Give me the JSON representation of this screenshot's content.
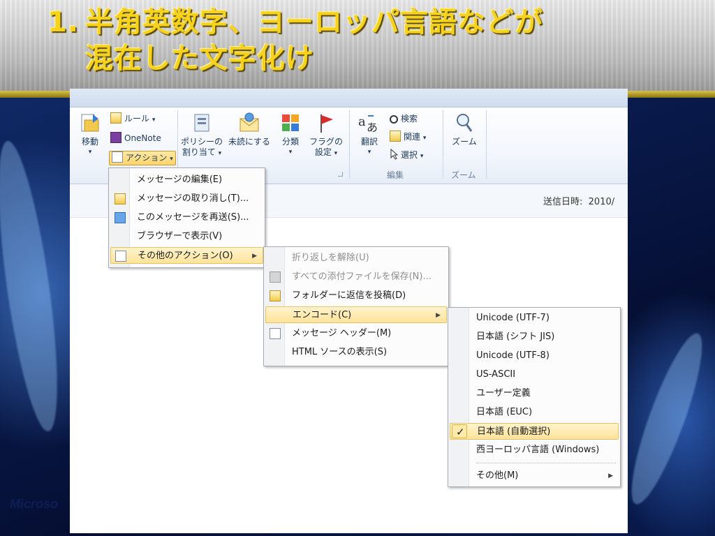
{
  "slide": {
    "title_number": "1.",
    "title_line1": "半角英数字、ヨーロッパ言語などが",
    "title_line2": "混在した文字化け",
    "footer": "Microso"
  },
  "ribbon": {
    "move_label": "移動",
    "rules_label": "ルール",
    "onenote_label": "OneNote",
    "actions_label": "アクション",
    "policy_label_1": "ポリシーの",
    "policy_label_2": "割り当て",
    "unread_label": "未読にする",
    "categorize_label": "分類",
    "flag_label_1": "フラグの",
    "flag_label_2": "設定",
    "translate_label": "翻訳",
    "find_label": "検索",
    "related_label": "関連",
    "select_label": "選択",
    "edit_group": "編集",
    "zoom_label": "ズーム",
    "zoom_group": "ズーム"
  },
  "info": {
    "sent_label": "送信日時:",
    "sent_value": "2010/"
  },
  "menu_actions": [
    {
      "label": "メッセージの編集(E)"
    },
    {
      "label": "メッセージの取り消し(T)..."
    },
    {
      "label": "このメッセージを再送(S)..."
    },
    {
      "label": "ブラウザーで表示(V)"
    },
    {
      "label": "その他のアクション(O)"
    }
  ],
  "menu_other": [
    {
      "label": "折り返しを解除(U)"
    },
    {
      "label": "すべての添付ファイルを保存(N)..."
    },
    {
      "label": "フォルダーに返信を投稿(D)"
    },
    {
      "label": "エンコード(C)"
    },
    {
      "label": "メッセージ ヘッダー(M)"
    },
    {
      "label": "HTML ソースの表示(S)"
    }
  ],
  "menu_encoding": [
    {
      "label": "Unicode (UTF-7)"
    },
    {
      "label": "日本語 (シフト JIS)"
    },
    {
      "label": "Unicode (UTF-8)"
    },
    {
      "label": "US-ASCII"
    },
    {
      "label": "ユーザー定義"
    },
    {
      "label": "日本語 (EUC)"
    },
    {
      "label": "日本語 (自動選択)"
    },
    {
      "label": "西ヨーロッパ言語 (Windows)"
    },
    {
      "label": "その他(M)"
    }
  ],
  "glyphs": {
    "check": "✓",
    "submenu_arrow": "▶",
    "dropdown_arrow": "▾"
  },
  "colors": {
    "title": "#f6d21e",
    "highlight": "#ffe39a",
    "ribbon_text": "#1e395b"
  }
}
